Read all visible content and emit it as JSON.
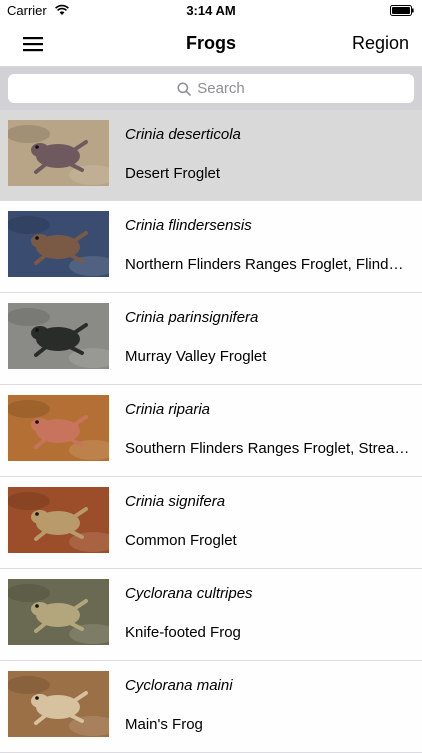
{
  "status_bar": {
    "carrier": "Carrier",
    "time": "3:14 AM"
  },
  "nav": {
    "title": "Frogs",
    "right_button": "Region",
    "menu_icon": "hamburger-menu-icon"
  },
  "search": {
    "placeholder": "Search",
    "icon": "search-icon"
  },
  "frogs": [
    {
      "scientific": "Crinia deserticola",
      "common": "Desert Froglet",
      "selected": true,
      "colors": {
        "bg": "#b8a486",
        "frog": "#6e5a5e"
      }
    },
    {
      "scientific": "Crinia flindersensis",
      "common": "Northern Flinders Ranges Froglet, Flinders…",
      "selected": false,
      "colors": {
        "bg": "#3a4c70",
        "frog": "#7a5a45"
      }
    },
    {
      "scientific": "Crinia parinsignifera",
      "common": "Murray Valley Froglet",
      "selected": false,
      "colors": {
        "bg": "#8a8a86",
        "frog": "#2a2c2a"
      }
    },
    {
      "scientific": "Crinia riparia",
      "common": "Southern Flinders Ranges Froglet, Streamb…",
      "selected": false,
      "colors": {
        "bg": "#b47034",
        "frog": "#c8735c"
      }
    },
    {
      "scientific": "Crinia signifera",
      "common": "Common Froglet",
      "selected": false,
      "colors": {
        "bg": "#9c4e2a",
        "frog": "#b99a6a"
      }
    },
    {
      "scientific": "Cyclorana cultripes",
      "common": "Knife-footed Frog",
      "selected": false,
      "colors": {
        "bg": "#6a6a52",
        "frog": "#b4a67c"
      }
    },
    {
      "scientific": "Cyclorana maini",
      "common": "Main's Frog",
      "selected": false,
      "colors": {
        "bg": "#9c7046",
        "frog": "#d6c29e"
      }
    }
  ]
}
